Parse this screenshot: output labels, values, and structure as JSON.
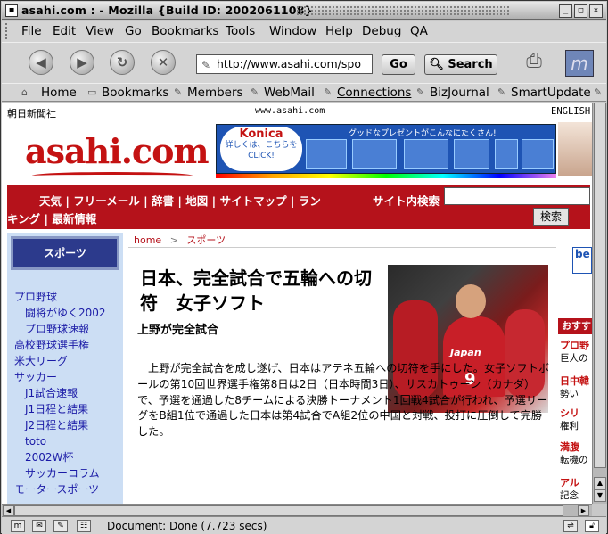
{
  "window": {
    "title": "asahi.com : - Mozilla {Build ID: 2002061108}",
    "buttons": [
      "_",
      "□",
      "×"
    ]
  },
  "menu": [
    "File",
    "Edit",
    "View",
    "Go",
    "Bookmarks",
    "Tools",
    "Window",
    "Help",
    "Debug",
    "QA"
  ],
  "nav": {
    "url": "http://www.asahi.com/spo",
    "go_label": "Go",
    "search_label": "Search"
  },
  "personal_toolbar": [
    "Home",
    "Bookmarks",
    "Members",
    "WebMail",
    "Connections",
    "BizJournal",
    "SmartUpdate"
  ],
  "page": {
    "top_left": "朝日新聞社",
    "top_center": "www.asahi.com",
    "top_right": "ENGLISH",
    "logo": "asahi.com",
    "ad": {
      "brand": "Konica",
      "cta": "詳しくは、こちらをCLICK!",
      "tagline": "グッドなプレゼントがこんなにたくさん!"
    },
    "nav_line1": "天気 | フリーメール | 辞書 | 地図 | サイトマップ | ラン",
    "nav_line2": "キング | 最新情報",
    "search_label": "サイト内検索",
    "search_button": "検索",
    "sidebar_title": "スポーツ",
    "sidebar_items": [
      {
        "label": "プロ野球",
        "level": 1
      },
      {
        "label": "闘将がゆく2002",
        "level": 2
      },
      {
        "label": "プロ野球速報",
        "level": 2
      },
      {
        "label": "高校野球選手権",
        "level": 1
      },
      {
        "label": "米大リーグ",
        "level": 1
      },
      {
        "label": "サッカー",
        "level": 1
      },
      {
        "label": "J1試合速報",
        "level": 2
      },
      {
        "label": "J1日程と結果",
        "level": 2
      },
      {
        "label": "J2日程と結果",
        "level": 2
      },
      {
        "label": "toto",
        "level": 2
      },
      {
        "label": "2002W杯",
        "level": 2
      },
      {
        "label": "サッカーコラム",
        "level": 2
      },
      {
        "label": "モータースポーツ",
        "level": 1
      }
    ],
    "breadcrumb_home": "home",
    "breadcrumb_sep": ">",
    "breadcrumb_section": "スポーツ",
    "headline": "日本、完全試合で五輪への切符　女子ソフト",
    "subhead": "上野が完全試合",
    "photo_jersey": "Japan",
    "photo_number": "9",
    "body": "上野が完全試合を成し遂げ、日本はアテネ五輪への切符を手にした。女子ソフトボールの第10回世界選手権第8日は2日（日本時間3日）、サスカトゥーン（カナダ）で、予選を通過した8チームによる決勝トーナメント1回戦4試合が行われ、予選リーグをB組1位で通過した日本は第4試合でA組2位の中国と対戦、投打に圧倒して完勝した。",
    "right_ad": "be",
    "right_label": "おすす",
    "right_items": [
      {
        "title": "プロ野",
        "desc": "巨人の"
      },
      {
        "title": "日中韓",
        "desc": "勢い"
      },
      {
        "title": "シリ",
        "desc": "権利"
      },
      {
        "title": "満腹",
        "desc": "転機の"
      },
      {
        "title": "アル",
        "desc": "記念"
      }
    ]
  },
  "status": {
    "text": "Document: Done (7.723 secs)"
  }
}
